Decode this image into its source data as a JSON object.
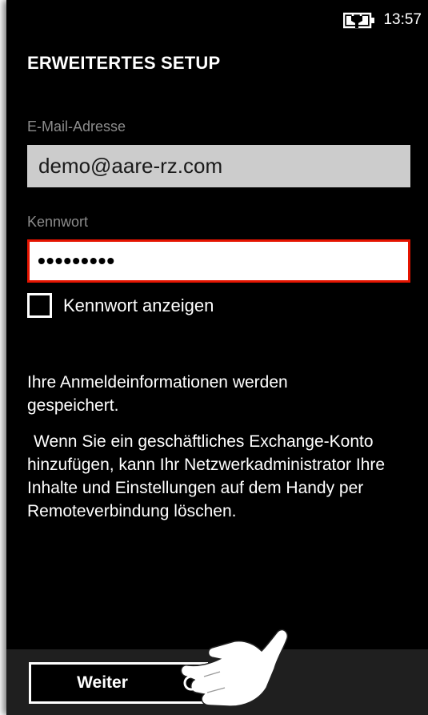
{
  "status_bar": {
    "time": "13:57",
    "battery_icon": "battery-charging-icon"
  },
  "page": {
    "title": "ERWEITERTES SETUP"
  },
  "email": {
    "label": "E-Mail-Adresse",
    "value": "demo@aare-rz.com"
  },
  "password": {
    "label": "Kennwort",
    "value": "•••••••••",
    "show_label": "Kennwort anzeigen",
    "show_checked": false
  },
  "info": {
    "line1": "Ihre Anmeldeinformationen werden gespeichert.",
    "line2": "Wenn Sie ein geschäftliches Exchange-Konto hinzufügen, kann Ihr Netzwerkadministrator Ihre Inhalte und Einstellungen auf dem Handy per Remoteverbindung löschen."
  },
  "app_bar": {
    "next_label": "Weiter"
  },
  "colors": {
    "background": "#000000",
    "accent_error": "#e51400",
    "field_disabled": "#cccccc",
    "appbar": "#1f1f1f"
  }
}
